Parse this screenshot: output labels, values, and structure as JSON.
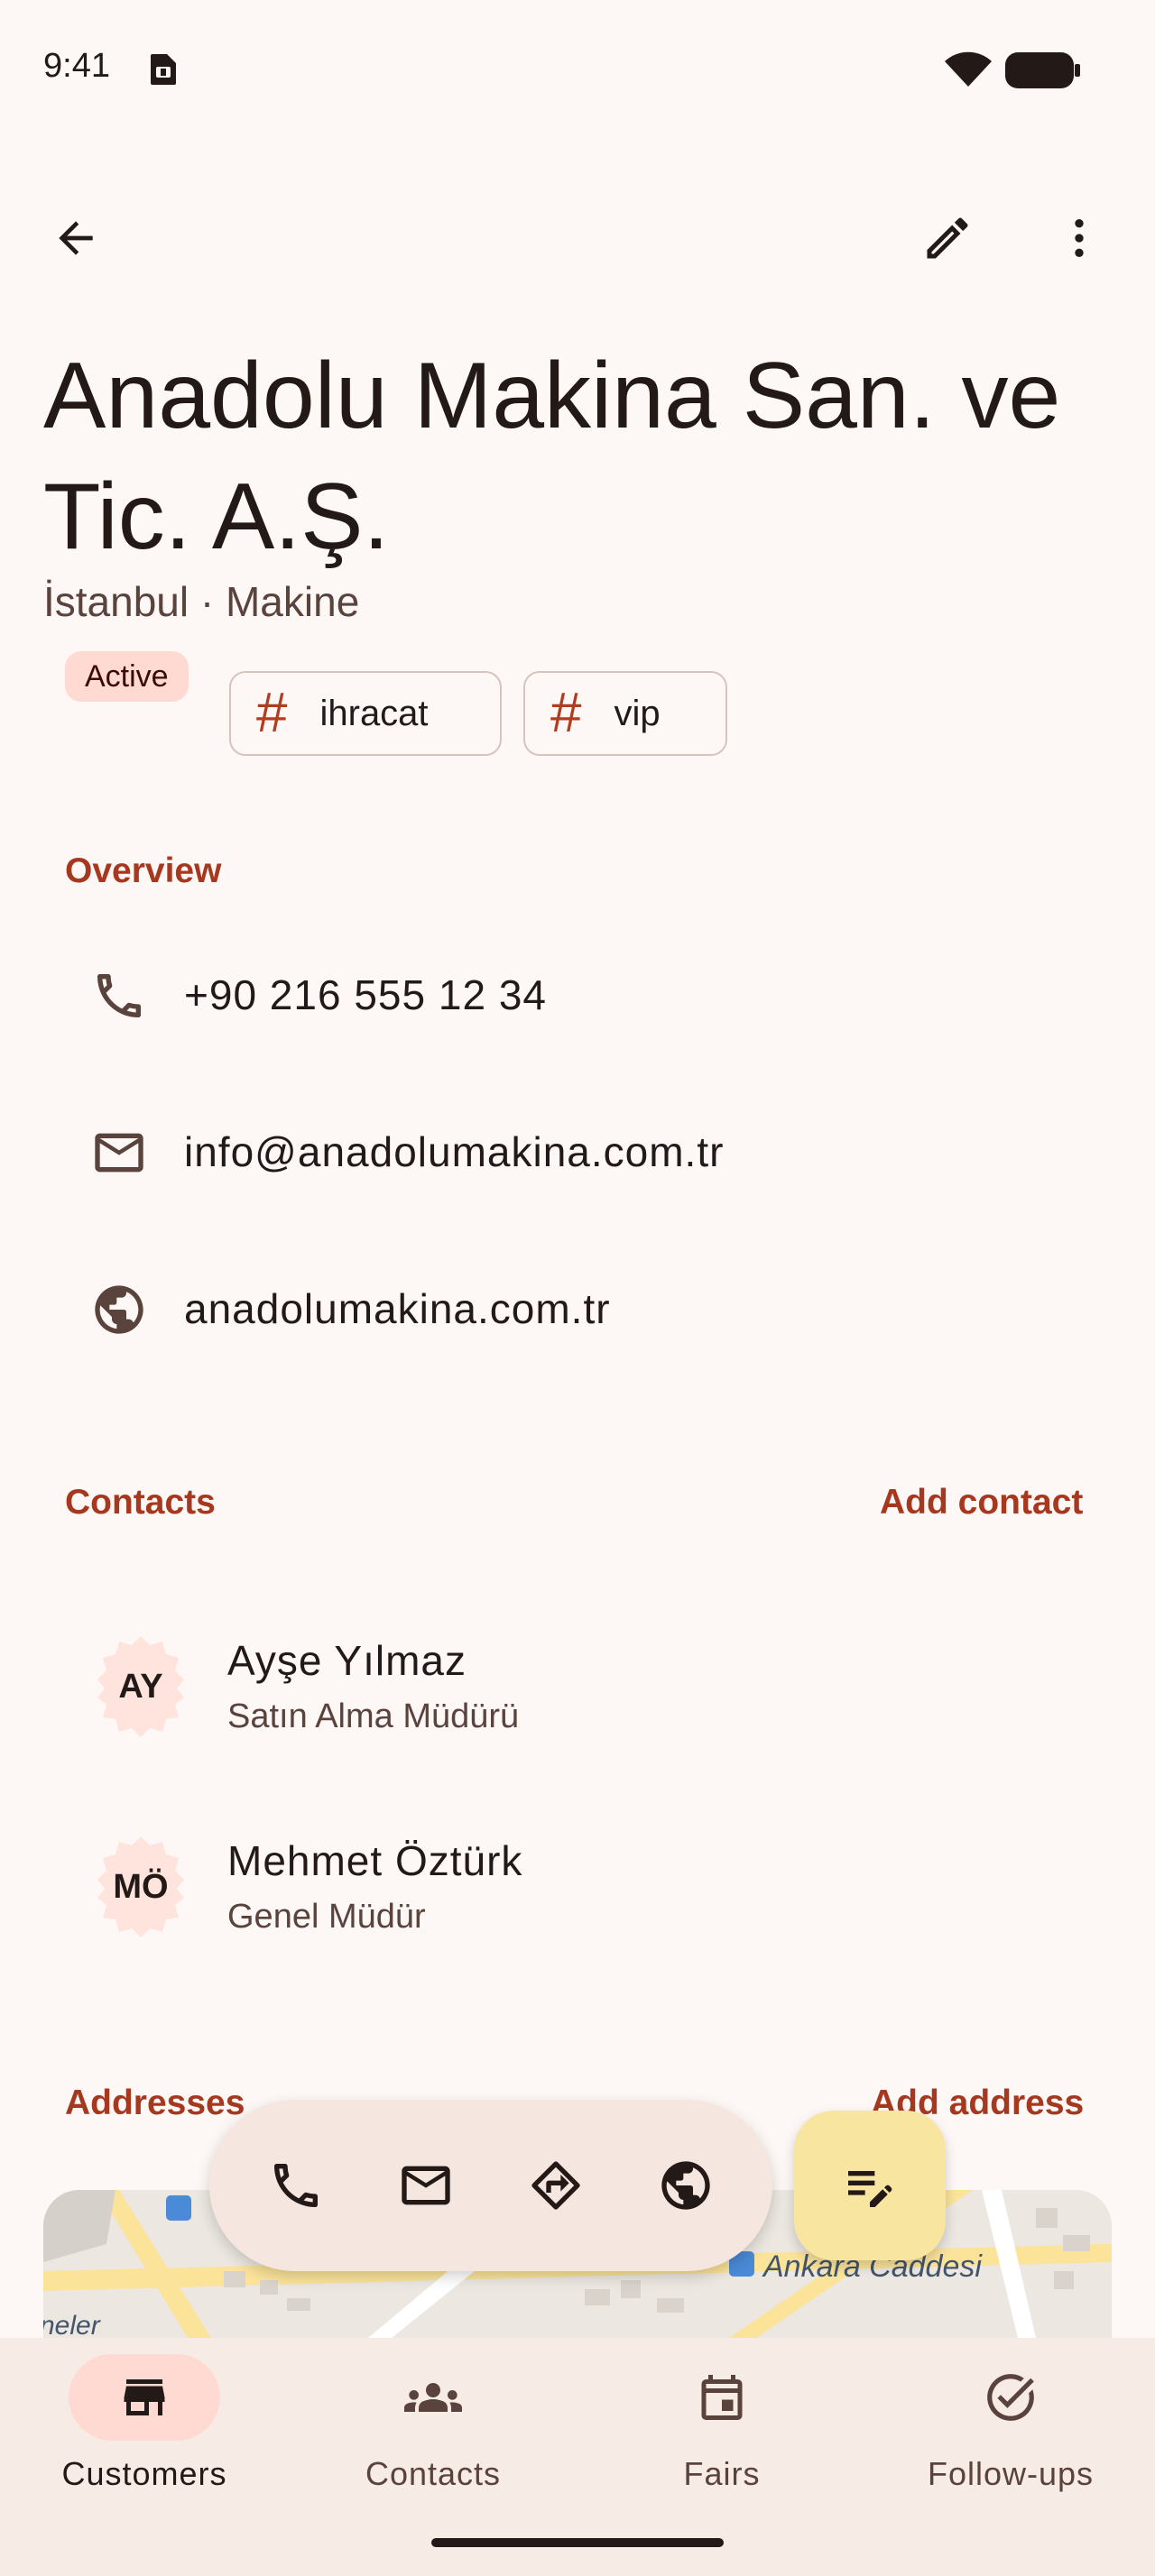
{
  "status_bar": {
    "time": "9:41"
  },
  "company": {
    "name": "Anadolu Makina San. ve Tic. A.Ş.",
    "subtitle": "İstanbul · Makine",
    "status": "Active",
    "tags": [
      "ihracat",
      "vip"
    ]
  },
  "overview": {
    "label": "Overview",
    "phone": "+90 216 555 12 34",
    "email": "info@anadolumakina.com.tr",
    "website": "anadolumakina.com.tr"
  },
  "contacts": {
    "label": "Contacts",
    "add_label": "Add contact",
    "items": [
      {
        "initials": "AY",
        "name": "Ayşe Yılmaz",
        "role": "Satın Alma Müdürü"
      },
      {
        "initials": "MÖ",
        "name": "Mehmet Öztürk",
        "role": "Genel Müdür"
      }
    ]
  },
  "addresses": {
    "label": "Addresses",
    "add_label": "Add address",
    "map_labels": [
      "Ankara Caddesi",
      "neler"
    ]
  },
  "bottom_nav": {
    "items": [
      {
        "label": "Customers",
        "icon": "storefront-icon",
        "active": true
      },
      {
        "label": "Contacts",
        "icon": "group-icon",
        "active": false
      },
      {
        "label": "Fairs",
        "icon": "calendar-icon",
        "active": false
      },
      {
        "label": "Follow-ups",
        "icon": "check-circle-icon",
        "active": false
      }
    ]
  },
  "colors": {
    "background": "#FDF8F5",
    "accent": "#A6381F",
    "status_chip": "#FFDAD3",
    "fab": "#F8E6A0",
    "nav_background": "#F7EBE6"
  }
}
